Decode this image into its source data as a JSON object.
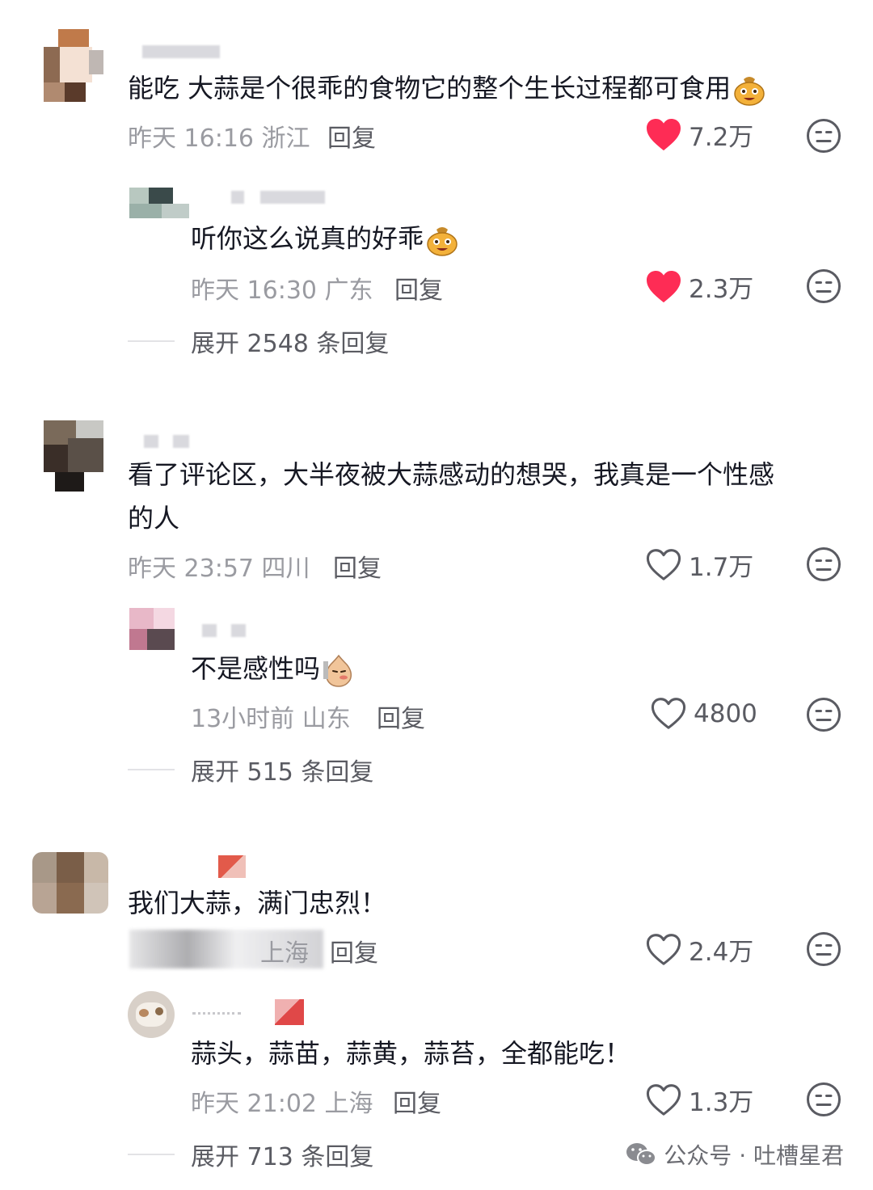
{
  "comments": [
    {
      "text": "能吃 大蒜是个很乖的食物它的整个生长过程都可食用",
      "emoji": "grinning-bag-emoji",
      "meta": "昨天 16:16 浙江",
      "reply_label": "回复",
      "likes": "7.2万",
      "liked": true,
      "replies": [
        {
          "text": "听你这么说真的好乖",
          "emoji": "grinning-bag-emoji",
          "meta": "昨天 16:30 广东",
          "reply_label": "回复",
          "likes": "2.3万",
          "liked": true
        }
      ],
      "expand": "展开 2548 条回复"
    },
    {
      "text_line1": "看了评论区，大半夜被大蒜感动的想哭，我真是一个性感",
      "text_line2": "的人",
      "meta": "昨天 23:57 四川",
      "reply_label": "回复",
      "likes": "1.7万",
      "liked": false,
      "replies": [
        {
          "text": "不是感性吗",
          "emoji": "smug-garlic-emoji",
          "meta": "13小时前 山东",
          "reply_label": "回复",
          "likes": "4800",
          "liked": false
        }
      ],
      "expand": "展开 515 条回复"
    },
    {
      "text": "我们大蒜，满门忠烈！",
      "meta": "上海",
      "reply_label": "回复",
      "likes": "2.4万",
      "liked": false,
      "replies": [
        {
          "text": "蒜头，蒜苗，蒜黄，蒜苔，全都能吃！",
          "meta": "昨天 21:02 上海",
          "reply_label": "回复",
          "likes": "1.3万",
          "liked": false
        }
      ],
      "expand": "展开 713 条回复"
    }
  ],
  "watermark": "公众号 · 吐槽星君",
  "colors": {
    "liked": "#fe2c55",
    "text": "#161823",
    "meta": "#9a9ba1"
  }
}
